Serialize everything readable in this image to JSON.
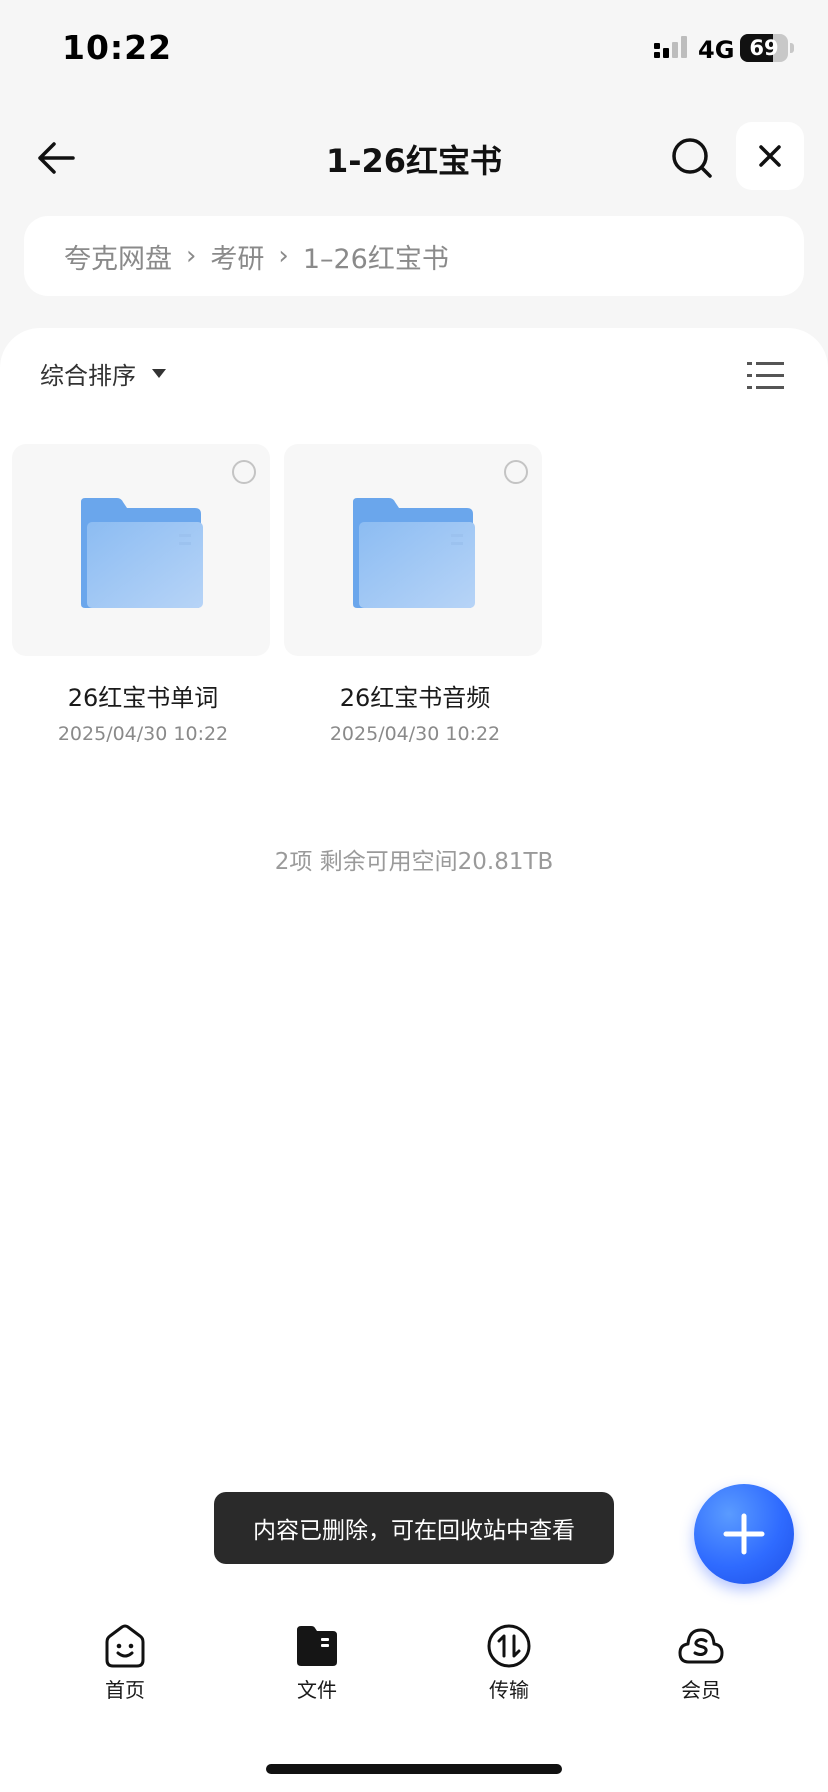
{
  "status_bar": {
    "time": "10:22",
    "network": "4G",
    "battery_text": "69",
    "battery_level": 0.69,
    "icons": [
      "signal-bars-icon",
      "battery-icon"
    ]
  },
  "header": {
    "title": "1-26红宝书",
    "icons": [
      "back-arrow-icon",
      "search-icon",
      "close-icon"
    ]
  },
  "breadcrumb": {
    "items": [
      "夸克网盘",
      "考研",
      "1–26红宝书"
    ],
    "separator": "›"
  },
  "toolbar": {
    "sort_label": "综合排序",
    "icons": [
      "dropdown-caret-icon",
      "list-view-icon"
    ]
  },
  "files": [
    {
      "name": "26红宝书单词",
      "date": "2025/04/30 10:22",
      "icon": "folder-icon"
    },
    {
      "name": "26红宝书音频",
      "date": "2025/04/30 10:22",
      "icon": "folder-icon"
    }
  ],
  "storage_info": "2项 剩余可用空间20.81TB",
  "toast": "内容已删除，可在回收站中查看",
  "fab": {
    "icon": "plus-icon",
    "color": "#2f6bff"
  },
  "tabbar": {
    "items": [
      {
        "label": "首页",
        "icon": "home-face-icon"
      },
      {
        "label": "文件",
        "icon": "files-folder-icon"
      },
      {
        "label": "传输",
        "icon": "transfer-icon"
      },
      {
        "label": "会员",
        "icon": "member-cloud-icon"
      }
    ]
  },
  "colors": {
    "accent": "#2f6bff",
    "background": "#f6f6f6",
    "folder": "#7ab2f0"
  }
}
